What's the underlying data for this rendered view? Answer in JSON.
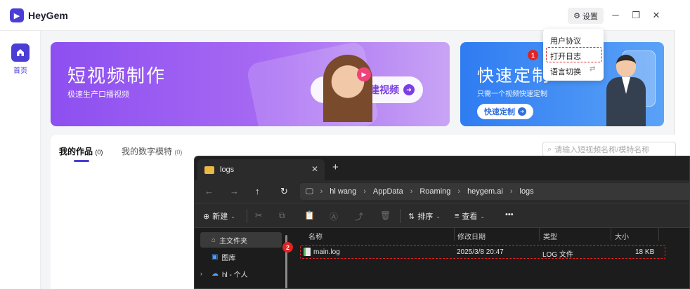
{
  "app": {
    "name": "HeyGem",
    "settings_label": "设置",
    "nav": {
      "home_label": "首页"
    },
    "banner_left": {
      "title": "短视频制作",
      "subtitle": "极速生产口播视频",
      "button": "创建视频"
    },
    "banner_right": {
      "title": "快速定制",
      "subtitle": "只需一个视频快速定制",
      "button": "快速定制"
    },
    "works": {
      "tab_mine": "我的作品",
      "tab_mine_count": "(0)",
      "tab_models": "我的数字模特",
      "tab_models_count": "(0)",
      "search_placeholder": "请输入短视频名称/模特名称"
    },
    "dropdown": {
      "items": [
        "用户协议",
        "打开日志",
        "语言切换"
      ]
    }
  },
  "markers": [
    "1",
    "2"
  ],
  "explorer": {
    "tab_title": "logs",
    "path": [
      "hl wang",
      "AppData",
      "Roaming",
      "heygem.ai",
      "logs"
    ],
    "toolbar": {
      "new": "新建",
      "sort": "排序",
      "view": "查看"
    },
    "nav_pane": [
      "主文件夹",
      "图库",
      "hl - 个人"
    ],
    "columns": [
      "名称",
      "修改日期",
      "类型",
      "大小"
    ],
    "files": [
      {
        "name": "main.log",
        "modified": "2025/3/8 20:47",
        "type": "LOG 文件",
        "size": "18 KB"
      }
    ]
  },
  "colors": {
    "brand": "#4a3ed6",
    "highlight": "#e02323"
  }
}
